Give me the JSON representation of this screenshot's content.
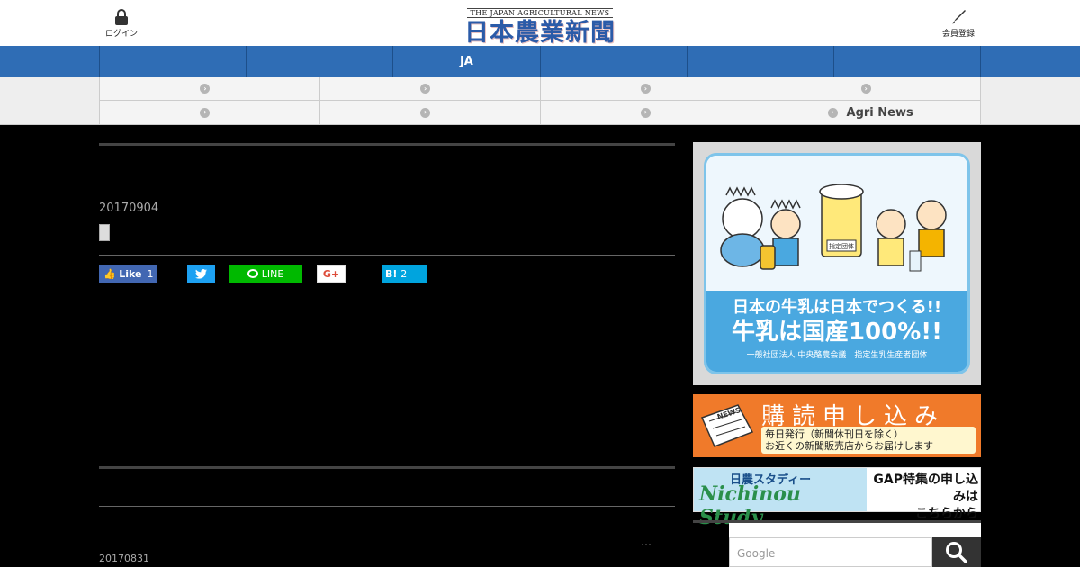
{
  "header": {
    "login_label": "ログイン",
    "register_label": "会員登録",
    "logo_sub": "THE JAPAN AGRICULTURAL NEWS",
    "logo_main": "日本農業新聞"
  },
  "nav": {
    "items": [
      "",
      "",
      "JA",
      "",
      "",
      ""
    ]
  },
  "subnav": {
    "cells": [
      "",
      "",
      "",
      "",
      "",
      "",
      "",
      "Agri News"
    ]
  },
  "article": {
    "date": "20170904",
    "share": {
      "like_label": "Like",
      "like_count": "1",
      "line_label": "LINE",
      "gplus_label": "G+",
      "hatena_label": "B!",
      "hatena_count": "2"
    }
  },
  "next": {
    "date": "20170831",
    "ellipsis": "…"
  },
  "sidebar": {
    "ad_milk": {
      "badge": "指定団体",
      "line1": "日本の牛乳は日本でつくる!!",
      "line2": "牛乳は国産100%!!",
      "line3": "一般社団法人 中央酪農会議　指定生乳生産者団体"
    },
    "ad_subscribe": {
      "title": "購読申し込み",
      "line1": "毎日発行（新聞休刊日を除く）",
      "line2": "お近くの新聞販売店からお届けします",
      "icon_text": "NEWS"
    },
    "ad_study": {
      "top": "日農スタディー",
      "big": "Nichinou Study",
      "right1": "GAP特集の申し込みは",
      "right2": "こちらから"
    },
    "search": {
      "placeholder": "Google"
    }
  },
  "colors": {
    "nav": "#2f6db5",
    "logo": "#2b5ba8",
    "subscribe": "#f07a2a"
  }
}
